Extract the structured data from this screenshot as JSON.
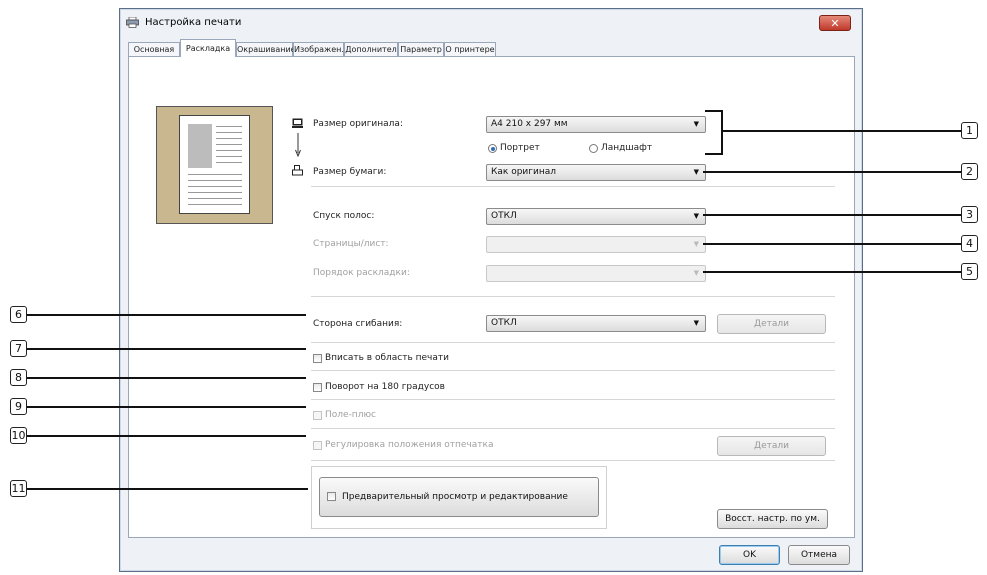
{
  "window": {
    "title": "Настройка печати",
    "close_label": "✕"
  },
  "tabs": [
    "Основная",
    "Раскладка",
    "Окрашивание",
    "Изображен.",
    "Дополнител",
    "Параметр",
    "О принтере"
  ],
  "layout": {
    "original_size_label": "Размер оригинала:",
    "original_size_value": "A4 210 x 297 мм",
    "orientation_portrait": "Портрет",
    "orientation_landscape": "Ландшафт",
    "paper_size_label": "Размер бумаги:",
    "paper_size_value": "Как оригинал",
    "imposition_label": "Спуск полос:",
    "imposition_value": "ОТКЛ",
    "pages_per_sheet_label": "Страницы/лист:",
    "layout_order_label": "Порядок раскладки:",
    "fold_side_label": "Сторона сгибания:",
    "fold_side_value": "ОТКЛ",
    "details_label": "Детали",
    "fit_print_area": "Вписать в область печати",
    "rotate_180": "Поворот на 180 градусов",
    "margin_plus": "Поле-плюс",
    "print_position": "Регулировка положения отпечатка",
    "preview_edit": "Предварительный просмотр и редактирование",
    "restore_defaults": "Восст. настр. по ум."
  },
  "footer": {
    "ok": "OK",
    "cancel": "Отмена"
  },
  "callouts": [
    "1",
    "2",
    "3",
    "4",
    "5",
    "6",
    "7",
    "8",
    "9",
    "10",
    "11"
  ]
}
